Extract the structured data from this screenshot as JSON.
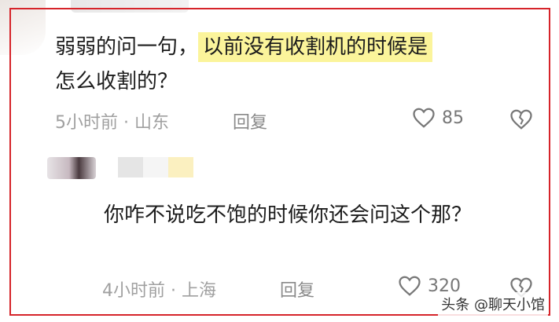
{
  "comment1": {
    "text_plain": "弱弱的问一句，",
    "text_highlight": "以前没有收割机的时候是",
    "text_tail": "怎么收割的？",
    "meta": "5小时前 · 山东",
    "reply_label": "回复",
    "likes": "85"
  },
  "comment2": {
    "text": "你咋不说吃不饱的时候你还会问这个那？",
    "meta": "4小时前 · 上海",
    "reply_label": "回复",
    "likes": "320"
  },
  "watermark": "头条 @聊天小馆",
  "colors": {
    "highlight": "#fbf49b",
    "frame": "#d6242a"
  },
  "icons": {
    "like": "heart-outline-icon",
    "dislike": "broken-heart-icon"
  }
}
